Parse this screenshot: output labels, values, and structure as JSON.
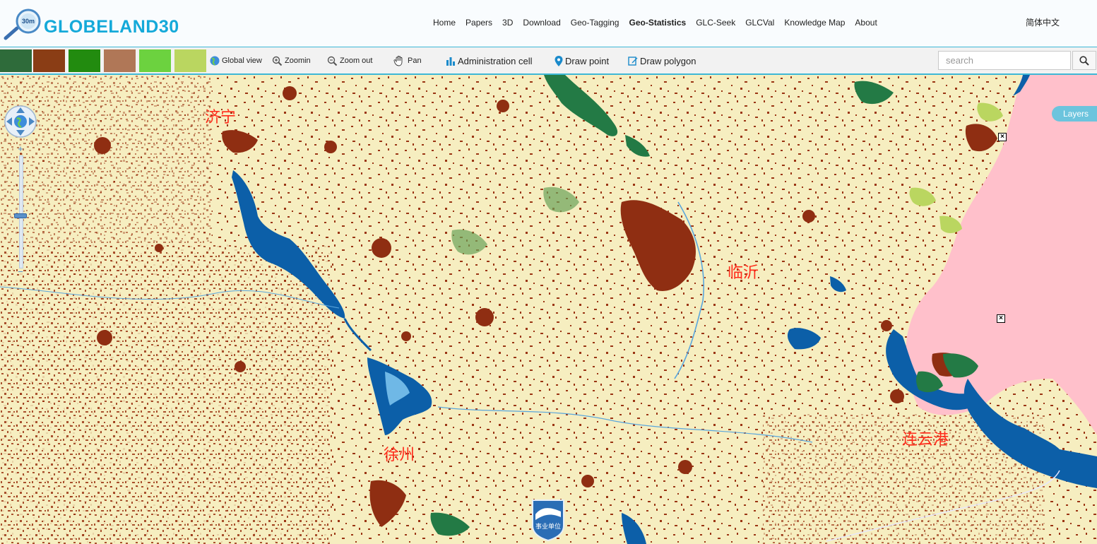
{
  "header": {
    "logo_badge": "30m",
    "logo_text": "GLOBELAND30",
    "nav": [
      {
        "label": "Home",
        "active": false
      },
      {
        "label": "Papers",
        "active": false
      },
      {
        "label": "3D",
        "active": false
      },
      {
        "label": "Download",
        "active": false
      },
      {
        "label": "Geo-Tagging",
        "active": false
      },
      {
        "label": "Geo-Statistics",
        "active": true
      },
      {
        "label": "GLC-Seek",
        "active": false
      },
      {
        "label": "GLCVal",
        "active": false
      },
      {
        "label": "Knowledge Map",
        "active": false
      },
      {
        "label": "About",
        "active": false
      }
    ],
    "language": "简体中文"
  },
  "toolbar": {
    "swatch_colors": [
      "#2e6b3a",
      "#8a3d15",
      "#228b0f",
      "#b07757",
      "#6cd23f",
      "#bad660"
    ],
    "tools": {
      "global_view": "Global view",
      "zoom_in": "Zoomin",
      "zoom_out": "Zoom out",
      "pan": "Pan",
      "admin_cell": "Administration cell",
      "draw_point": "Draw point",
      "draw_polygon": "Draw polygon"
    },
    "search": {
      "placeholder": "search",
      "value": ""
    }
  },
  "map": {
    "layers_button": "Layers",
    "cities": {
      "jining": "济宁",
      "linyi": "临沂",
      "xuzhou": "徐州",
      "lianyungang": "连云港"
    },
    "badge_text": "事业单位",
    "legend_colors": {
      "cultivated": "#f6eec0",
      "artificial": "#8f2e12",
      "water": "#0c5fa8",
      "sea": "#ffc0cb",
      "forest": "#237a45",
      "grass": "#8fc85a"
    }
  }
}
